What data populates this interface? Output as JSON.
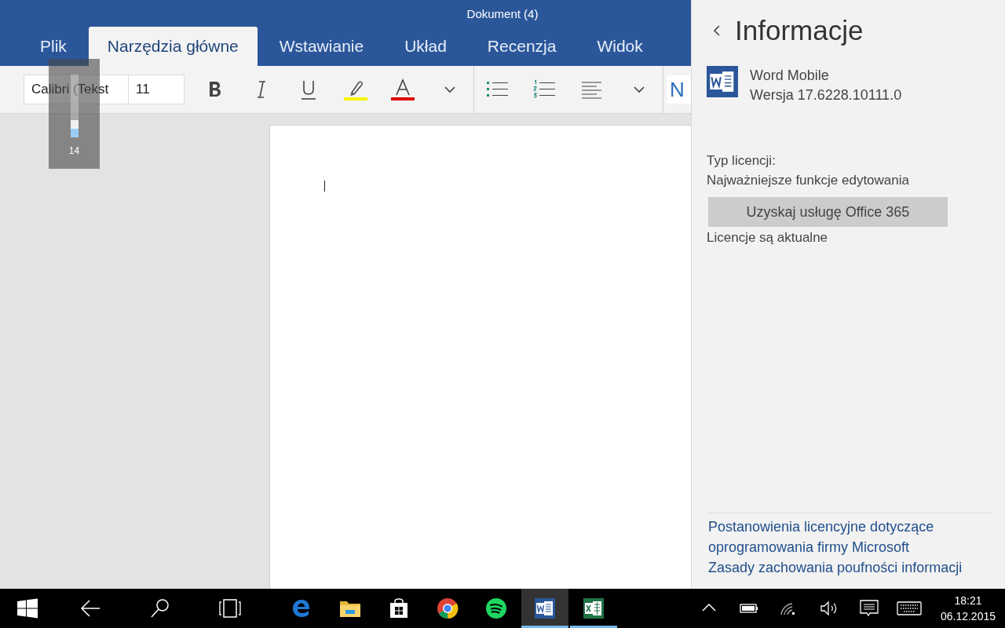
{
  "window": {
    "title": "Dokument (4)"
  },
  "tabs": [
    {
      "label": "Plik",
      "selected": false
    },
    {
      "label": "Narzędzia główne",
      "selected": true
    },
    {
      "label": "Wstawianie",
      "selected": false
    },
    {
      "label": "Układ",
      "selected": false
    },
    {
      "label": "Recenzja",
      "selected": false
    },
    {
      "label": "Widok",
      "selected": false
    }
  ],
  "ribbon": {
    "font_field": {
      "value": "Calibri (Tekst"
    },
    "size_field": {
      "value": "11"
    },
    "tools": [
      {
        "kind": "bold"
      },
      {
        "kind": "italic"
      },
      {
        "kind": "underline"
      },
      {
        "kind": "highlight"
      },
      {
        "kind": "font-color"
      },
      {
        "kind": "more"
      },
      {
        "kind": "separator"
      },
      {
        "kind": "bullets"
      },
      {
        "kind": "numbering"
      },
      {
        "kind": "align"
      },
      {
        "kind": "more"
      },
      {
        "kind": "separator"
      }
    ],
    "styles_preview": "N"
  },
  "volume_overlay": {
    "level": 0.14,
    "reading": "14"
  },
  "info_panel": {
    "title": "Informacje",
    "app_name": "Word Mobile",
    "version": "Wersja 17.6228.10111.0",
    "license_label": "Typ licencji:",
    "license_type": "Najważniejsze funkcje edytowania",
    "button": "Uzyskaj usługę Office 365",
    "license_status": "Licencje są aktualne",
    "links": [
      "Postanowienia licencyjne dotyczące oprogramowania firmy Microsoft",
      "Zasady zachowania poufności informacji"
    ]
  },
  "taskbar": {
    "buttons": [
      {
        "kind": "start"
      },
      {
        "kind": "back"
      },
      {
        "kind": "search"
      },
      {
        "kind": "task-view"
      }
    ],
    "apps": [
      {
        "kind": "edge",
        "running": false,
        "selected": false
      },
      {
        "kind": "explorer",
        "running": false,
        "selected": false
      },
      {
        "kind": "store",
        "running": false,
        "selected": false
      },
      {
        "kind": "chrome",
        "running": false,
        "selected": false
      },
      {
        "kind": "spotify",
        "running": false,
        "selected": false
      },
      {
        "kind": "word",
        "running": true,
        "selected": true
      },
      {
        "kind": "excel",
        "running": true,
        "selected": false
      }
    ],
    "tray": [
      {
        "kind": "chevron"
      },
      {
        "kind": "battery"
      },
      {
        "kind": "wifi"
      },
      {
        "kind": "volume"
      },
      {
        "kind": "action-center"
      },
      {
        "kind": "keyboard"
      }
    ],
    "clock": {
      "time": "18:21",
      "date": "06.12.2015"
    }
  }
}
